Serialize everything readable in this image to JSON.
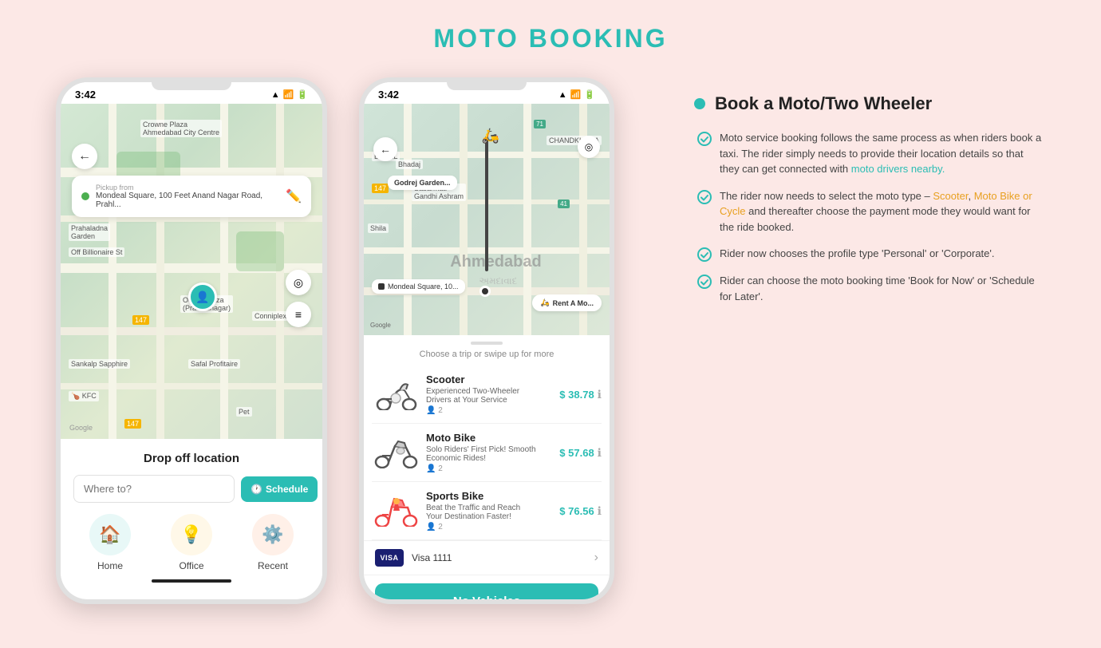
{
  "page": {
    "title": "MOTO BOOKING",
    "background": "#fce8e6"
  },
  "left_phone": {
    "status_time": "3:42",
    "map": {
      "pickup_label": "Pickup from",
      "pickup_address": "Mondeal Square, 100 Feet Anand Nagar Road, Prahl...",
      "back_icon": "←"
    },
    "bottom_panel": {
      "title": "Drop off location",
      "where_to_placeholder": "Where to?",
      "schedule_label": "Schedule",
      "destinations": [
        {
          "icon": "🏠",
          "label": "Home",
          "type": "home"
        },
        {
          "icon": "💡",
          "label": "Office",
          "type": "office"
        },
        {
          "icon": "⚙️",
          "label": "Recent",
          "type": "recent"
        }
      ]
    }
  },
  "right_phone": {
    "status_time": "3:42",
    "map": {
      "destination_label": "Godrej Garden...",
      "origin_label": "Mondeal Square, 10...",
      "rent_label": "Rent A Mo...",
      "ahmedabad": "Ahmedabad",
      "ahmedabad_guj": "અમદાવાદ"
    },
    "booking_panel": {
      "swipe_hint": "Choose a trip or swipe up for more",
      "vehicles": [
        {
          "name": "Scooter",
          "description": "Experienced Two-Wheeler Drivers at Your Service",
          "capacity": "2",
          "price": "$ 38.78",
          "icon": "🛵"
        },
        {
          "name": "Moto Bike",
          "description": "Solo Riders' First Pick! Smooth Economic Rides!",
          "capacity": "2",
          "price": "$ 57.68",
          "icon": "🏍️"
        },
        {
          "name": "Sports Bike",
          "description": "Beat the Traffic and Reach Your Destination Faster!",
          "capacity": "2",
          "price": "$ 76.56",
          "icon": "🏍️"
        }
      ],
      "payment": {
        "card_type": "VISA",
        "card_number": "Visa 1111"
      },
      "book_button": "No Vehicles"
    }
  },
  "info_panel": {
    "title": "Book a Moto/Two Wheeler",
    "bullets": [
      {
        "text": "Moto service booking follows the same process as when riders book a taxi. The rider simply needs to provide their location details so that they can get connected with moto drivers nearby.",
        "highlight_words": [
          "moto drivers nearby"
        ]
      },
      {
        "text": "The rider now needs to select the moto type – Scooter, Moto Bike or Cycle and thereafter choose the payment mode they would want for the ride booked.",
        "highlight_words": [
          "Scooter",
          "Moto Bike or Cycle"
        ]
      },
      {
        "text": "Rider now chooses the profile type 'Personal' or 'Corporate'.",
        "highlight_words": []
      },
      {
        "text": "Rider can choose the moto booking time 'Book for Now' or 'Schedule for Later'.",
        "highlight_words": []
      }
    ]
  }
}
